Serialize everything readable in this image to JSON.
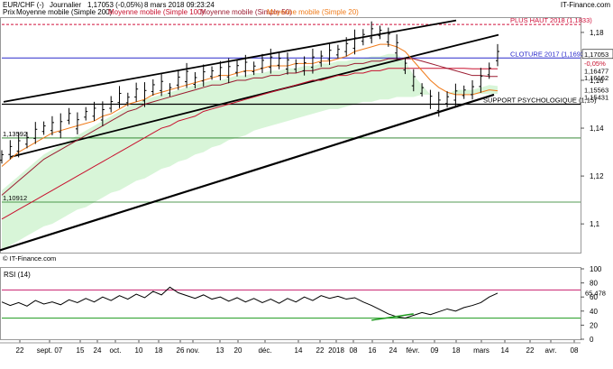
{
  "header": {
    "instrument": "EUR/CHF (-)",
    "period": "Journalier",
    "quote": "1,17053 (-0,05%)",
    "timestamp": "8 mars 2018 09:23:24",
    "source": "IT-Finance.com"
  },
  "legend": {
    "price": "Prix",
    "ma200": "Moyenne mobile (Simple 200)",
    "ma100": "Moyenne mobile (Simple 100)",
    "ma50": "Moyenne mobile (Simple 50)",
    "ma20": "Moyenne mobile (Simple 20)"
  },
  "colors": {
    "ma200": "#000000",
    "ma100": "#c8102e",
    "ma50": "#9b1b30",
    "ma20": "#f07b1a",
    "area": "#d8f5d8",
    "close_line": "#2a2acc",
    "high_line": "#d0103a",
    "support_line": "#000000",
    "rsi_upper": "#c8206e",
    "rsi_lower": "#1c9a1c"
  },
  "chart_data": [
    {
      "type": "line",
      "title": "EUR/CHF (-) Journalier",
      "ylim": [
        1.088,
        1.186
      ],
      "y_ticks": [
        "1,18",
        "1,16",
        "1,14",
        "1,12",
        "1,1"
      ],
      "y_tick_values": [
        1.18,
        1.16,
        1.14,
        1.12,
        1.1
      ],
      "x_ticks": [
        "22",
        "sept. 07",
        "15",
        "24",
        "oct.",
        "10",
        "18",
        "26",
        "nov.",
        "13",
        "20",
        "déc.",
        "14",
        "22",
        "2018",
        "08",
        "16",
        "24",
        "févr.",
        "09",
        "18",
        "mars",
        "14",
        "22",
        "avr.",
        "08"
      ],
      "price": [
        1.128,
        1.131,
        1.133,
        1.135,
        1.138,
        1.14,
        1.141,
        1.141,
        1.145,
        1.142,
        1.146,
        1.147,
        1.146,
        1.15,
        1.153,
        1.152,
        1.155,
        1.154,
        1.157,
        1.158,
        1.156,
        1.16,
        1.162,
        1.16,
        1.162,
        1.163,
        1.164,
        1.164,
        1.165,
        1.166,
        1.165,
        1.167,
        1.168,
        1.168,
        1.167,
        1.166,
        1.166,
        1.168,
        1.169,
        1.171,
        1.172,
        1.174,
        1.176,
        1.178,
        1.18,
        1.18,
        1.178,
        1.174,
        1.166,
        1.16,
        1.156,
        1.152,
        1.15,
        1.152,
        1.154,
        1.155,
        1.156,
        1.16,
        1.164,
        1.1705
      ],
      "ma20": [
        1.124,
        1.127,
        1.13,
        1.132,
        1.134,
        1.136,
        1.138,
        1.139,
        1.14,
        1.141,
        1.142,
        1.143,
        1.145,
        1.146,
        1.148,
        1.15,
        1.151,
        1.152,
        1.154,
        1.155,
        1.156,
        1.157,
        1.158,
        1.159,
        1.16,
        1.161,
        1.162,
        1.162,
        1.163,
        1.164,
        1.164,
        1.165,
        1.166,
        1.166,
        1.166,
        1.167,
        1.167,
        1.167,
        1.168,
        1.168,
        1.169,
        1.17,
        1.172,
        1.173,
        1.174,
        1.175,
        1.175,
        1.174,
        1.172,
        1.168,
        1.164,
        1.16,
        1.157,
        1.155,
        1.154,
        1.154,
        1.154,
        1.155,
        1.156,
        1.1556
      ],
      "ma50": [
        1.112,
        1.115,
        1.118,
        1.121,
        1.124,
        1.127,
        1.129,
        1.131,
        1.133,
        1.135,
        1.137,
        1.139,
        1.141,
        1.143,
        1.145,
        1.147,
        1.148,
        1.15,
        1.151,
        1.152,
        1.153,
        1.154,
        1.155,
        1.156,
        1.157,
        1.158,
        1.158,
        1.159,
        1.16,
        1.16,
        1.161,
        1.161,
        1.162,
        1.162,
        1.163,
        1.163,
        1.164,
        1.164,
        1.165,
        1.165,
        1.166,
        1.166,
        1.167,
        1.167,
        1.168,
        1.168,
        1.169,
        1.169,
        1.169,
        1.169,
        1.168,
        1.167,
        1.166,
        1.165,
        1.164,
        1.163,
        1.162,
        1.162,
        1.1616,
        1.1616
      ],
      "ma100": [
        1.102,
        1.104,
        1.106,
        1.108,
        1.11,
        1.112,
        1.114,
        1.116,
        1.118,
        1.12,
        1.122,
        1.124,
        1.126,
        1.128,
        1.13,
        1.132,
        1.134,
        1.136,
        1.138,
        1.14,
        1.141,
        1.143,
        1.144,
        1.145,
        1.147,
        1.148,
        1.149,
        1.15,
        1.151,
        1.152,
        1.153,
        1.154,
        1.155,
        1.156,
        1.157,
        1.158,
        1.159,
        1.16,
        1.16,
        1.161,
        1.162,
        1.162,
        1.163,
        1.163,
        1.164,
        1.164,
        1.165,
        1.165,
        1.165,
        1.165,
        1.165,
        1.165,
        1.165,
        1.165,
        1.165,
        1.165,
        1.1648,
        1.1648,
        1.1648,
        1.1648
      ],
      "ma200": [
        1.089,
        1.091,
        1.093,
        1.095,
        1.097,
        1.099,
        1.1,
        1.102,
        1.104,
        1.106,
        1.107,
        1.109,
        1.111,
        1.113,
        1.114,
        1.116,
        1.118,
        1.119,
        1.121,
        1.123,
        1.124,
        1.126,
        1.127,
        1.129,
        1.13,
        1.132,
        1.133,
        1.135,
        1.136,
        1.137,
        1.139,
        1.14,
        1.141,
        1.142,
        1.143,
        1.144,
        1.145,
        1.146,
        1.147,
        1.148,
        1.148,
        1.149,
        1.15,
        1.151,
        1.151,
        1.152,
        1.152,
        1.153,
        1.153,
        1.153,
        1.154,
        1.154,
        1.154,
        1.154,
        1.1543,
        1.1543,
        1.1543,
        1.1543,
        1.1543,
        1.1543
      ],
      "levels": [
        {
          "label": "PLUS HAUT 2018 (1,1833)",
          "value": 1.1833
        },
        {
          "label": "CLOTURE 2017 (1,16932)",
          "value": 1.16932
        },
        {
          "label": "SUPPORT PSYCHOLOGIQUE (1,15)",
          "value": 1.15
        },
        {
          "label": "",
          "value": 1.1359
        },
        {
          "label": "",
          "value": 1.1091
        }
      ],
      "level_values": {
        "low1": "1,13592",
        "low2": "1,10912"
      },
      "right_labels": [
        "1,17053",
        "-0,05%",
        "1,16477",
        "1,16162",
        "1,15563",
        "1,15431"
      ]
    },
    {
      "type": "line",
      "title": "RSI (14)",
      "ylim": [
        0,
        100
      ],
      "y_ticks": [
        "100",
        "80",
        "60",
        "40",
        "20",
        "0"
      ],
      "y_tick_values": [
        100,
        80,
        60,
        40,
        20,
        0
      ],
      "levels": [
        70,
        30
      ],
      "values": [
        53,
        48,
        52,
        47,
        55,
        50,
        53,
        49,
        56,
        52,
        58,
        53,
        60,
        55,
        62,
        57,
        64,
        59,
        68,
        63,
        74,
        66,
        62,
        58,
        63,
        57,
        60,
        54,
        59,
        53,
        58,
        52,
        57,
        51,
        58,
        53,
        60,
        55,
        62,
        58,
        61,
        57,
        59,
        53,
        48,
        42,
        36,
        32,
        30,
        34,
        38,
        35,
        39,
        43,
        40,
        45,
        48,
        52,
        60,
        65.478
      ],
      "current_label": "65,478"
    }
  ]
}
